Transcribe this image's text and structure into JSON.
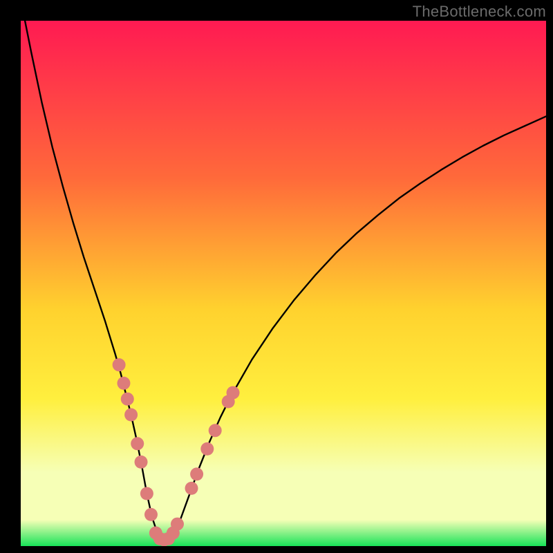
{
  "watermark": "TheBottleneck.com",
  "colors": {
    "frame": "#000000",
    "curve": "#000000",
    "dot_fill": "#dd7c7a",
    "grad_top": "#ff1a52",
    "grad_mid1": "#ff6a3a",
    "grad_mid2": "#ffd22e",
    "grad_yellow": "#ffef3e",
    "grad_pale": "#f6ffb6",
    "grad_green": "#18e358"
  },
  "chart_data": {
    "type": "line",
    "title": "",
    "xlabel": "",
    "ylabel": "",
    "xlim": [
      0,
      100
    ],
    "ylim": [
      0,
      100
    ],
    "series": [
      {
        "name": "bottleneck-curve",
        "x": [
          0.8,
          2,
          4,
          6,
          8,
          10,
          12,
          14,
          16,
          18,
          19,
          20,
          21,
          22,
          23,
          24,
          25,
          26,
          27,
          28,
          30,
          32,
          34,
          36,
          38,
          40,
          44,
          48,
          52,
          56,
          60,
          64,
          68,
          72,
          76,
          80,
          84,
          88,
          92,
          96,
          100
        ],
        "y": [
          100,
          94,
          84.5,
          76,
          68.5,
          61.5,
          55,
          49,
          43,
          36.5,
          33,
          29,
          25,
          20.5,
          15.5,
          10,
          5.5,
          2.5,
          1.2,
          1.2,
          4,
          9.5,
          15,
          20,
          24.5,
          28.5,
          35.5,
          41.5,
          46.8,
          51.5,
          55.8,
          59.6,
          63,
          66.2,
          69,
          71.6,
          74,
          76.2,
          78.2,
          80,
          81.8
        ]
      }
    ],
    "dots": [
      {
        "x": 18.7,
        "y": 34.5
      },
      {
        "x": 19.6,
        "y": 31.0
      },
      {
        "x": 20.3,
        "y": 28.0
      },
      {
        "x": 21.0,
        "y": 25.0
      },
      {
        "x": 22.2,
        "y": 19.5
      },
      {
        "x": 22.9,
        "y": 16.0
      },
      {
        "x": 24.0,
        "y": 10.0
      },
      {
        "x": 24.8,
        "y": 6.0
      },
      {
        "x": 25.7,
        "y": 2.5
      },
      {
        "x": 26.5,
        "y": 1.4
      },
      {
        "x": 27.3,
        "y": 1.2
      },
      {
        "x": 28.1,
        "y": 1.4
      },
      {
        "x": 29.0,
        "y": 2.5
      },
      {
        "x": 29.8,
        "y": 4.2
      },
      {
        "x": 32.5,
        "y": 11.0
      },
      {
        "x": 33.5,
        "y": 13.7
      },
      {
        "x": 35.5,
        "y": 18.5
      },
      {
        "x": 37.0,
        "y": 22.0
      },
      {
        "x": 39.5,
        "y": 27.5
      },
      {
        "x": 40.4,
        "y": 29.2
      }
    ],
    "gradient_stops": [
      {
        "pct": 0,
        "color_key": "grad_top"
      },
      {
        "pct": 30,
        "color_key": "grad_mid1"
      },
      {
        "pct": 55,
        "color_key": "grad_mid2"
      },
      {
        "pct": 72,
        "color_key": "grad_yellow"
      },
      {
        "pct": 86,
        "color_key": "grad_pale"
      },
      {
        "pct": 95,
        "color_key": "grad_pale"
      },
      {
        "pct": 100,
        "color_key": "grad_green"
      }
    ]
  }
}
